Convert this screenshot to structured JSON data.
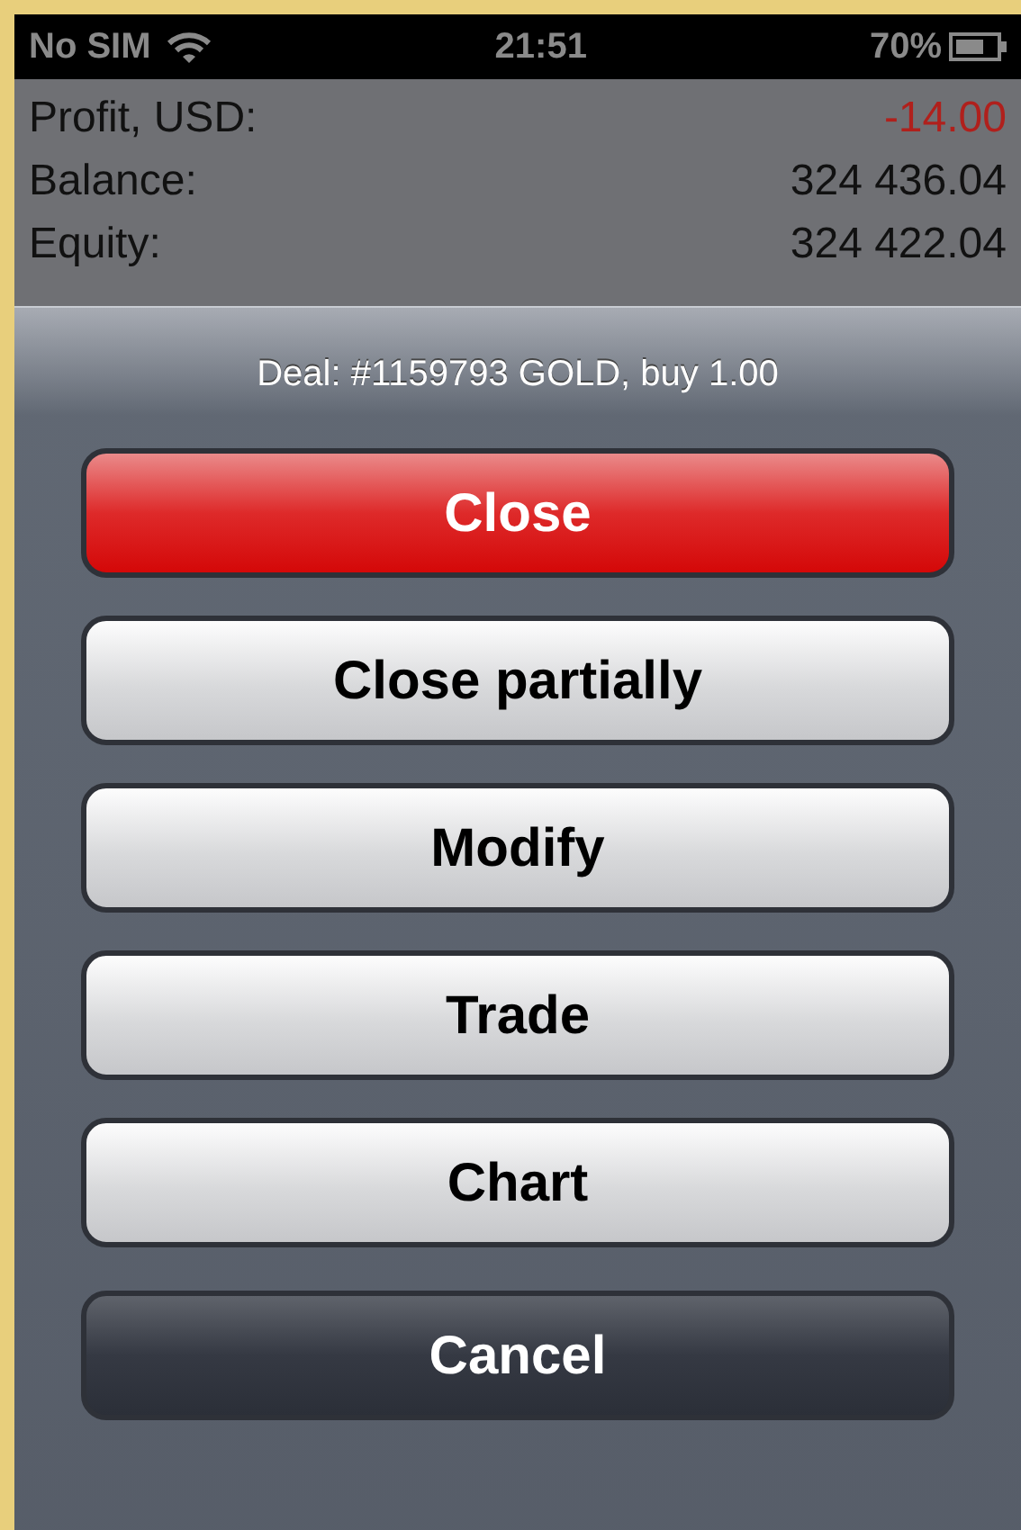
{
  "status_bar": {
    "carrier": "No SIM",
    "time": "21:51",
    "battery": "70%"
  },
  "summary": [
    {
      "label": "Profit, USD:",
      "value": "-14.00",
      "kind": "loss"
    },
    {
      "label": "Balance:",
      "value": "324 436.04",
      "kind": "plain"
    },
    {
      "label": "Equity:",
      "value": "324 422.04",
      "kind": "plain"
    }
  ],
  "action_sheet": {
    "title": "Deal: #1159793 GOLD, buy 1.00",
    "buttons": [
      {
        "label": "Close",
        "kind": "destructive"
      },
      {
        "label": "Close partially",
        "kind": "default"
      },
      {
        "label": "Modify",
        "kind": "default"
      },
      {
        "label": "Trade",
        "kind": "default"
      },
      {
        "label": "Chart",
        "kind": "default"
      },
      {
        "label": "Cancel",
        "kind": "cancel"
      }
    ]
  }
}
